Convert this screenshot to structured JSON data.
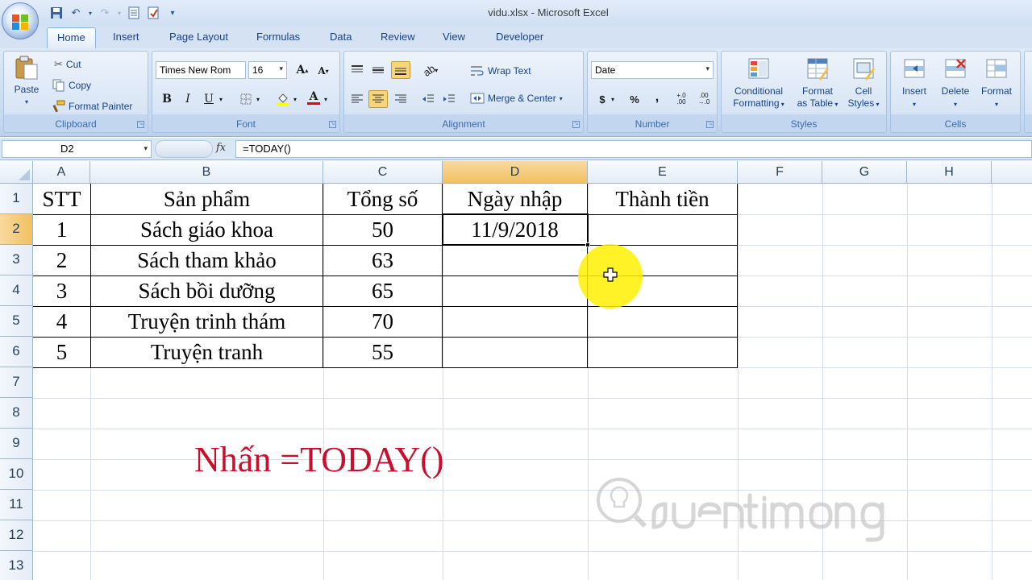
{
  "window": {
    "title": "vidu.xlsx - Microsoft Excel"
  },
  "tabs": [
    "Home",
    "Insert",
    "Page Layout",
    "Formulas",
    "Data",
    "Review",
    "View",
    "Developer"
  ],
  "ribbon": {
    "clipboard": {
      "label": "Clipboard",
      "paste": "Paste",
      "cut": "Cut",
      "copy": "Copy",
      "format_painter": "Format Painter"
    },
    "font": {
      "label": "Font",
      "font_name": "Times New Rom",
      "font_size": "16",
      "bold": "B",
      "italic": "I",
      "underline": "U"
    },
    "alignment": {
      "label": "Alignment",
      "wrap_text": "Wrap Text",
      "merge_center": "Merge & Center"
    },
    "number": {
      "label": "Number",
      "format": "Date",
      "currency": "$",
      "percent": "%",
      "comma": ",",
      "increase_decimal": "+.0 .00",
      "decrease_decimal": ".00 →.0"
    },
    "styles": {
      "label": "Styles",
      "conditional_1": "Conditional",
      "conditional_2": "Formatting",
      "format_table_1": "Format",
      "format_table_2": "as Table",
      "cell_styles_1": "Cell",
      "cell_styles_2": "Styles"
    },
    "cells": {
      "label": "Cells",
      "insert": "Insert",
      "delete": "Delete",
      "format": "Format"
    }
  },
  "formula_bar": {
    "name_box": "D2",
    "fx": "fx",
    "formula": "=TODAY()"
  },
  "columns": [
    "A",
    "B",
    "C",
    "D",
    "E",
    "F",
    "G",
    "H"
  ],
  "rows": [
    "1",
    "2",
    "3",
    "4",
    "5",
    "6",
    "7",
    "8",
    "9",
    "10",
    "11",
    "12",
    "13"
  ],
  "sheet": {
    "header": [
      "STT",
      "Sản phẩm",
      "Tổng số",
      "Ngày nhập",
      "Thành tiền"
    ],
    "rows": [
      [
        "1",
        "Sách giáo khoa",
        "50",
        "11/9/2018",
        ""
      ],
      [
        "2",
        "Sách tham khảo",
        "63",
        "",
        ""
      ],
      [
        "3",
        "Sách bồi dưỡng",
        "65",
        "",
        ""
      ],
      [
        "4",
        "Truyện trinh thám",
        "70",
        "",
        ""
      ],
      [
        "5",
        "Truyện tranh",
        "55",
        "",
        ""
      ]
    ]
  },
  "annotation": "Nhấn =TODAY()",
  "selected_cell": "D2",
  "colors": {
    "selected_header": "#f1c15f",
    "annotation": "#c8102e",
    "highlight": "#fff000"
  }
}
